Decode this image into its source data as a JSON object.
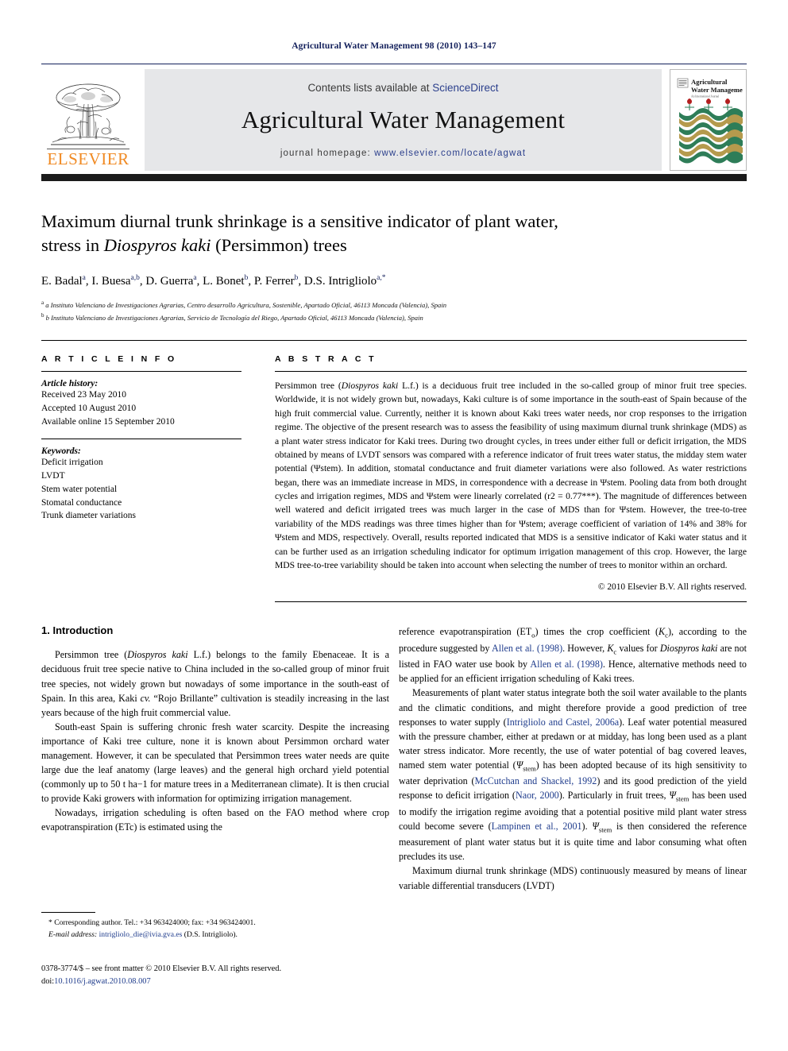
{
  "running_head": "Agricultural Water Management 98 (2010) 143–147",
  "masthead": {
    "contents_prefix": "Contents lists available at ",
    "contents_link": "ScienceDirect",
    "journal_name": "Agricultural Water Management",
    "homepage_prefix": "journal homepage: ",
    "homepage_url": "www.elsevier.com/locate/agwat",
    "publisher": "ELSEVIER",
    "cover_title_line1": "Agricultural",
    "cover_title_line2": "Water Management",
    "cover_subtitle": "An International Journal"
  },
  "article": {
    "title_line1": "Maximum diurnal trunk shrinkage is a sensitive indicator of plant water,",
    "title_line2_pre": "stress in ",
    "title_line2_italic": "Diospyros kaki",
    "title_line2_post": " (Persimmon) trees",
    "authors": "E. Badal a, I. Buesa a,b, D. Guerra a, L. Bonet b, P. Ferrer b, D.S. Intrigliolo a,*",
    "affiliation_a": "a Instituto Valenciano de Investigaciones Agrarias, Centro desarrollo Agricultura, Sostenible, Apartado Oficial, 46113 Moncada (Valencia), Spain",
    "affiliation_b": "b Instituto Valenciano de Investigaciones Agrarias, Servicio de Tecnología del Riego, Apartado Oficial, 46113 Moncada (Valencia), Spain"
  },
  "article_info": {
    "heading": "A R T I C L E   I N F O",
    "history_label": "Article history:",
    "history": [
      "Received 23 May 2010",
      "Accepted 10 August 2010",
      "Available online 15 September 2010"
    ],
    "keywords_label": "Keywords:",
    "keywords": [
      "Deficit irrigation",
      "LVDT",
      "Stem water potential",
      "Stomatal conductance",
      "Trunk diameter variations"
    ]
  },
  "abstract": {
    "heading": "A B S T R A C T",
    "text_part1": "Persimmon tree (",
    "text_italic1": "Diospyros kaki",
    "text_part2": " L.f.) is a deciduous fruit tree included in the so-called group of minor fruit tree species. Worldwide, it is not widely grown but, nowadays, Kaki culture is of some importance in the south-east of Spain because of the high fruit commercial value. Currently, neither it is known about Kaki trees water needs, nor crop responses to the irrigation regime. The objective of the present research was to assess the feasibility of using maximum diurnal trunk shrinkage (MDS) as a plant water stress indicator for Kaki trees. During two drought cycles, in trees under either full or deficit irrigation, the MDS obtained by means of LVDT sensors was compared with a reference indicator of fruit trees water status, the midday stem water potential (Ψstem). In addition, stomatal conductance and fruit diameter variations were also followed. As water restrictions began, there was an immediate increase in MDS, in correspondence with a decrease in Ψstem. Pooling data from both drought cycles and irrigation regimes, MDS and Ψstem were linearly correlated (r2 = 0.77***). The magnitude of differences between well watered and deficit irrigated trees was much larger in the case of MDS than for Ψstem. However, the tree-to-tree variability of the MDS readings was three times higher than for Ψstem; average coefficient of variation of 14% and 38% for Ψstem and MDS, respectively. Overall, results reported indicated that MDS is a sensitive indicator of Kaki water status and it can be further used as an irrigation scheduling indicator for optimum irrigation management of this crop. However, the large MDS tree-to-tree variability should be taken into account when selecting the number of trees to monitor within an orchard.",
    "copyright": "© 2010 Elsevier B.V. All rights reserved."
  },
  "introduction": {
    "heading": "1.  Introduction",
    "left_p1_part1": "Persimmon tree (",
    "left_p1_italic": "Diospyros kaki",
    "left_p1_part2": " L.f.) belongs to the family Ebenaceae. It is a deciduous fruit tree specie native to China included in the so-called group of minor fruit tree species, not widely grown but nowadays of some importance in the south-east of Spain. In this area, Kaki ",
    "left_p1_italic2": "cv.",
    "left_p1_part3": " “Rojo Brillante” cultivation is steadily increasing in the last years because of the high fruit commercial value.",
    "left_p2": "South-east Spain is suffering chronic fresh water scarcity. Despite the increasing importance of Kaki tree culture, none it is known about Persimmon orchard water management. However, it can be speculated that Persimmon trees water needs are quite large due the leaf anatomy (large leaves) and the general high orchard yield potential (commonly up to 50 t ha−1 for mature trees in a Mediterranean climate). It is then crucial to provide Kaki growers with information for optimizing irrigation management.",
    "left_p3": "Nowadays, irrigation scheduling is often based on the FAO method where crop evapotranspiration (ETc) is estimated using the",
    "right_p1": "reference evapotranspiration (ETo) times the crop coefficient (Kc), according to the procedure suggested by Allen et al. (1998). However, Kc values for Diospyros kaki are not listed in FAO water use book by Allen et al. (1998). Hence, alternative methods need to be applied for an efficient irrigation scheduling of Kaki trees.",
    "right_p2": "Measurements of plant water status integrate both the soil water available to the plants and the climatic conditions, and might therefore provide a good prediction of tree responses to water supply (Intrigliolo and Castel, 2006a). Leaf water potential measured with the pressure chamber, either at predawn or at midday, has long been used as a plant water stress indicator. More recently, the use of water potential of bag covered leaves, named stem water potential (Ψstem) has been adopted because of its high sensitivity to water deprivation (McCutchan and Shackel, 1992) and its good prediction of the yield response to deficit irrigation (Naor, 2000). Particularly in fruit trees, Ψstem has been used to modify the irrigation regime avoiding that a potential positive mild plant water stress could become severe (Lampinen et al., 2001). Ψstem is then considered the reference measurement of plant water status but it is quite time and labor consuming what often precludes its use.",
    "right_p3": "Maximum diurnal trunk shrinkage (MDS) continuously measured by means of linear variable differential transducers (LVDT)",
    "citations": [
      "Allen et al. (1998)",
      "Intrigliolo and Castel, 2006a",
      "McCutchan and Shackel, 1992",
      "Naor, 2000",
      "Lampinen et al., 2001"
    ]
  },
  "footnotes": {
    "corresponding": "* Corresponding author. Tel.: +34 963424000; fax: +34 963424001.",
    "email_label": "E-mail address:",
    "email": "intrigliolo_die@ivia.gva.es",
    "email_suffix": " (D.S. Intrigliolo)."
  },
  "imprint": {
    "line1": "0378-3774/$ – see front matter © 2010 Elsevier B.V. All rights reserved.",
    "doi_label": "doi:",
    "doi": "10.1016/j.agwat.2010.08.007"
  },
  "colors": {
    "header_blue": "#14215c",
    "link_blue": "#2b3f8c",
    "elsevier_orange": "#f08a23",
    "banner_grey": "#e6e7e9",
    "cover_green": "#2e7d58",
    "cover_gold": "#b59a4d",
    "cover_red": "#b32020"
  }
}
